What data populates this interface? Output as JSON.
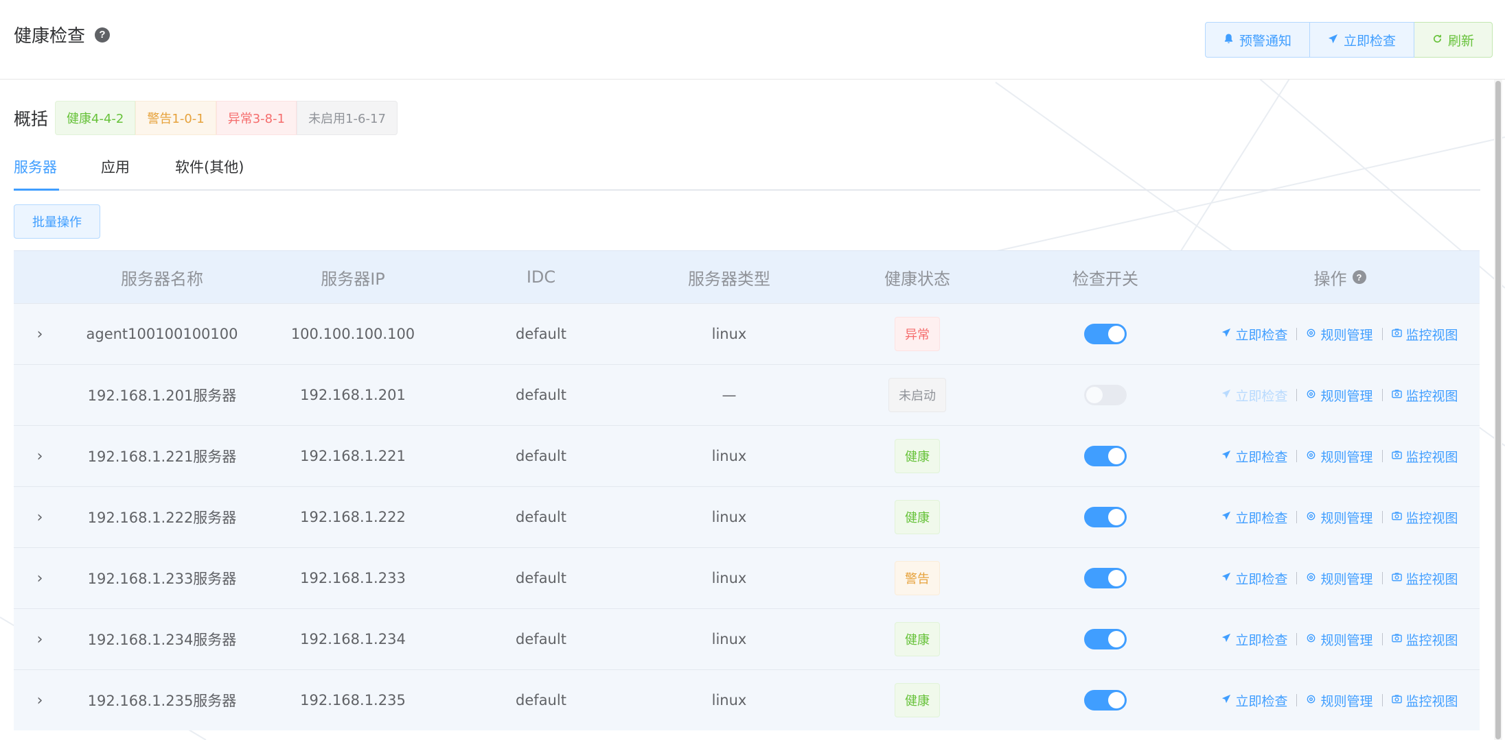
{
  "header": {
    "title": "健康检查",
    "help": "?",
    "buttons": [
      {
        "label": "预警通知",
        "icon": "bell-icon"
      },
      {
        "label": "立即检查",
        "icon": "send-icon"
      },
      {
        "label": "刷新",
        "icon": "refresh-icon"
      }
    ]
  },
  "summary": {
    "label": "概括",
    "tags": [
      {
        "label": "健康4-4-2"
      },
      {
        "label": "警告1-0-1"
      },
      {
        "label": "异常3-8-1"
      },
      {
        "label": "未启用1-6-17"
      }
    ]
  },
  "tabs": [
    {
      "label": "服务器",
      "active": true
    },
    {
      "label": "应用"
    },
    {
      "label": "软件(其他)"
    }
  ],
  "batch_button": "批量操作",
  "table": {
    "columns": [
      "服务器名称",
      "服务器IP",
      "IDC",
      "服务器类型",
      "健康状态",
      "检查开关",
      "操作"
    ],
    "actions": [
      "立即检查",
      "规则管理",
      "监控视图"
    ],
    "rows": [
      {
        "name": "agent100100100100",
        "ip": "100.100.100.100",
        "idc": "default",
        "type": "linux",
        "status": "异常",
        "switch_on": true,
        "expandable": true
      },
      {
        "name": "192.168.1.201服务器",
        "ip": "192.168.1.201",
        "idc": "default",
        "type": "—",
        "status": "未启动",
        "switch_on": false,
        "expandable": false
      },
      {
        "name": "192.168.1.221服务器",
        "ip": "192.168.1.221",
        "idc": "default",
        "type": "linux",
        "status": "健康",
        "switch_on": true,
        "expandable": true
      },
      {
        "name": "192.168.1.222服务器",
        "ip": "192.168.1.222",
        "idc": "default",
        "type": "linux",
        "status": "健康",
        "switch_on": true,
        "expandable": true
      },
      {
        "name": "192.168.1.233服务器",
        "ip": "192.168.1.233",
        "idc": "default",
        "type": "linux",
        "status": "警告",
        "switch_on": true,
        "expandable": true
      },
      {
        "name": "192.168.1.234服务器",
        "ip": "192.168.1.234",
        "idc": "default",
        "type": "linux",
        "status": "健康",
        "switch_on": true,
        "expandable": true
      },
      {
        "name": "192.168.1.235服务器",
        "ip": "192.168.1.235",
        "idc": "default",
        "type": "linux",
        "status": "健康",
        "switch_on": true,
        "expandable": true
      }
    ]
  },
  "colors": {
    "accent": "#409eff",
    "healthy": "#67c23a",
    "warning": "#e6a23c",
    "error": "#f56c6c",
    "disabled": "#909399"
  }
}
